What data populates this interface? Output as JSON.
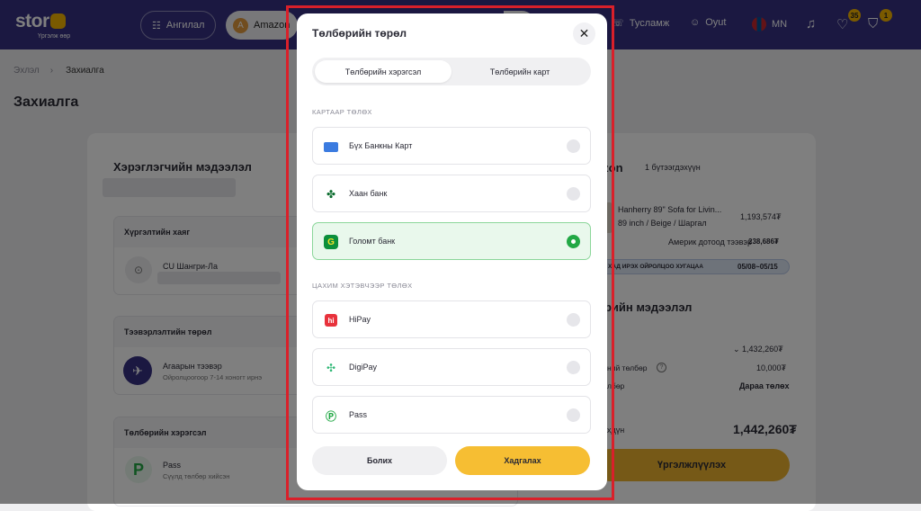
{
  "nav": {
    "logo": "stor",
    "logo_sub": "Үргэлж өөр",
    "category": "Ангилал",
    "store": "Amazon",
    "store_initial": "A",
    "help": "Тусламж",
    "user": "Oyut",
    "lang": "MN",
    "wishlist_count": "35",
    "cart_count": "1"
  },
  "breadcrumb": {
    "home": "Эхлэл",
    "current": "Захиалга"
  },
  "page": {
    "title": "Захиалга"
  },
  "left": {
    "user_info_title": "Хэрэглэгчийн мэдээлэл",
    "address_title": "Хүргэлтийн хаяг",
    "address_name": "CU Шангри-Ла",
    "shipping_title": "Тээвэрлэлтийн төрөл",
    "shipping_name": "Агаарын тээвэр",
    "shipping_desc": "Ойролцоогоор 7-14 хоногт ирнэ",
    "payment_title": "Төлбөрийн хэрэгсэл",
    "payment_name": "Pass",
    "payment_desc": "Сүүлд төлбөр хийсэн"
  },
  "right": {
    "store": "Amazon",
    "items_count": "1 бүтээгдэхүүн",
    "product_name": "Hanherry 89\" Sofa for Livin...",
    "product_desc": "89 inch / Beige / Шаргал",
    "product_price": "1,193,574₮",
    "us_ship_label": "Америк дотоод тээвэр",
    "us_ship_value": "238,686₮",
    "eta_label": "ХАД ИРЭХ ОЙРОЛЦОО ХУГАЦАА",
    "eta_value": "05/08~05/15",
    "summary_title": "Төлбөрийн мэдээлэл",
    "sum1_value": "1,432,260₮",
    "sum2_label": "ний төлбөр",
    "sum2_value": "10,000₮",
    "sum3_label": "лбөр",
    "sum3_value": "Дараа төлөх",
    "total_label": "хдүн",
    "total_value": "1,442,260₮",
    "continue": "Үргэлжлүүлэх"
  },
  "modal": {
    "title": "Төлбөрийн төрөл",
    "tabs": [
      "Төлбөрийн хэрэгсэл",
      "Төлбөрийн карт"
    ],
    "group_card": "КАРТААР ТӨЛӨХ",
    "group_wallet": "ЦАХИМ ХЭТЭВЧЭЭР ТӨЛӨХ",
    "options": [
      {
        "label": "Бүх Банкны Карт",
        "icon": "card-icon"
      },
      {
        "label": "Хаан банк",
        "icon": "khan-bank-icon"
      },
      {
        "label": "Голомт банк",
        "icon": "golomt-bank-icon",
        "selected": true
      },
      {
        "label": "HiPay",
        "icon": "hipay-icon"
      },
      {
        "label": "DigiPay",
        "icon": "digipay-icon"
      },
      {
        "label": "Pass",
        "icon": "pass-icon"
      }
    ],
    "cancel": "Болих",
    "save": "Хадгалах"
  },
  "colors": {
    "nav": "#363183",
    "accent": "#ecb22e",
    "selected": "#22a845",
    "highlight": "#d9202a"
  }
}
